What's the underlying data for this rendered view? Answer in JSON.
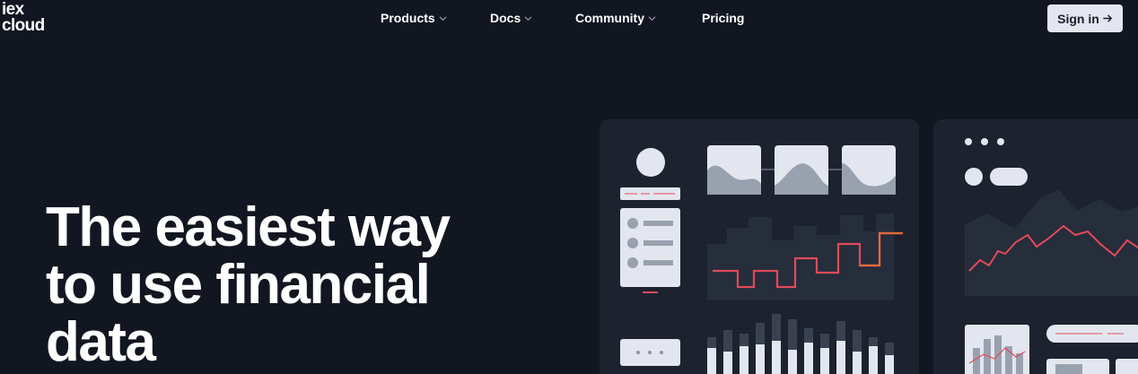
{
  "header": {
    "logo_line1": "iex",
    "logo_line2": "cloud",
    "nav": [
      {
        "label": "Products",
        "has_dropdown": true
      },
      {
        "label": "Docs",
        "has_dropdown": true
      },
      {
        "label": "Community",
        "has_dropdown": true
      },
      {
        "label": "Pricing",
        "has_dropdown": false
      }
    ],
    "signin_label": "Sign in",
    "signin_icon": "arrow-right-icon"
  },
  "hero": {
    "title_line1": "The easiest way",
    "title_line2": "to use financial",
    "title_line3": "data"
  },
  "colors": {
    "background": "#111620",
    "panel": "#1c222e",
    "card": "#e3e6ee",
    "muted": "#8e96a5",
    "accent_red": "#e04a5a",
    "accent_orange": "#e36a3c"
  }
}
